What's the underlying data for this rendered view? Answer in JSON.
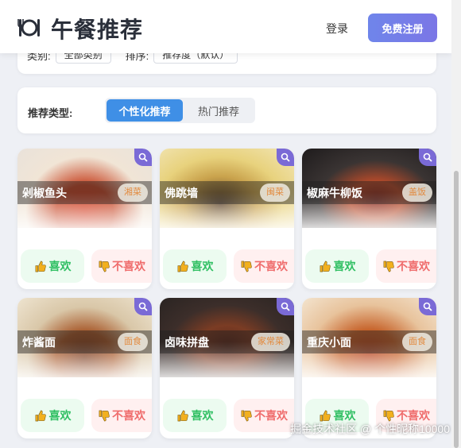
{
  "header": {
    "title": "午餐推荐",
    "login": "登录",
    "register": "免费注册"
  },
  "filters": {
    "category_label": "类别:",
    "category_value": "全部类别",
    "sort_label": "排序:",
    "sort_value": "推荐度（默认）"
  },
  "recommend": {
    "label": "推荐类型:",
    "tabs": [
      "个性化推荐",
      "热门推荐"
    ],
    "active": "个性化推荐"
  },
  "cards": [
    {
      "name": "剁椒鱼头",
      "tag": "湘菜",
      "like": "喜欢",
      "dislike": "不喜欢"
    },
    {
      "name": "佛跳墙",
      "tag": "闽菜",
      "like": "喜欢",
      "dislike": "不喜欢"
    },
    {
      "name": "椒麻牛柳饭",
      "tag": "盖饭",
      "like": "喜欢",
      "dislike": "不喜欢"
    },
    {
      "name": "炸酱面",
      "tag": "面食",
      "like": "喜欢",
      "dislike": "不喜欢"
    },
    {
      "name": "卤味拼盘",
      "tag": "家常菜",
      "like": "喜欢",
      "dislike": "不喜欢"
    },
    {
      "name": "重庆小面",
      "tag": "面食",
      "like": "喜欢",
      "dislike": "不喜欢"
    }
  ],
  "watermark": "掘金技术社区 @ 个性昵称10000",
  "colors": {
    "accent": "#3f8fe6",
    "register_gradient_start": "#6f85ea",
    "register_gradient_end": "#7b76e6",
    "like_green": "#2fbf62",
    "dislike_red": "#ef6b6b",
    "tag_orange": "#e28a3e",
    "zoom_badge": "#7a6ad6"
  }
}
